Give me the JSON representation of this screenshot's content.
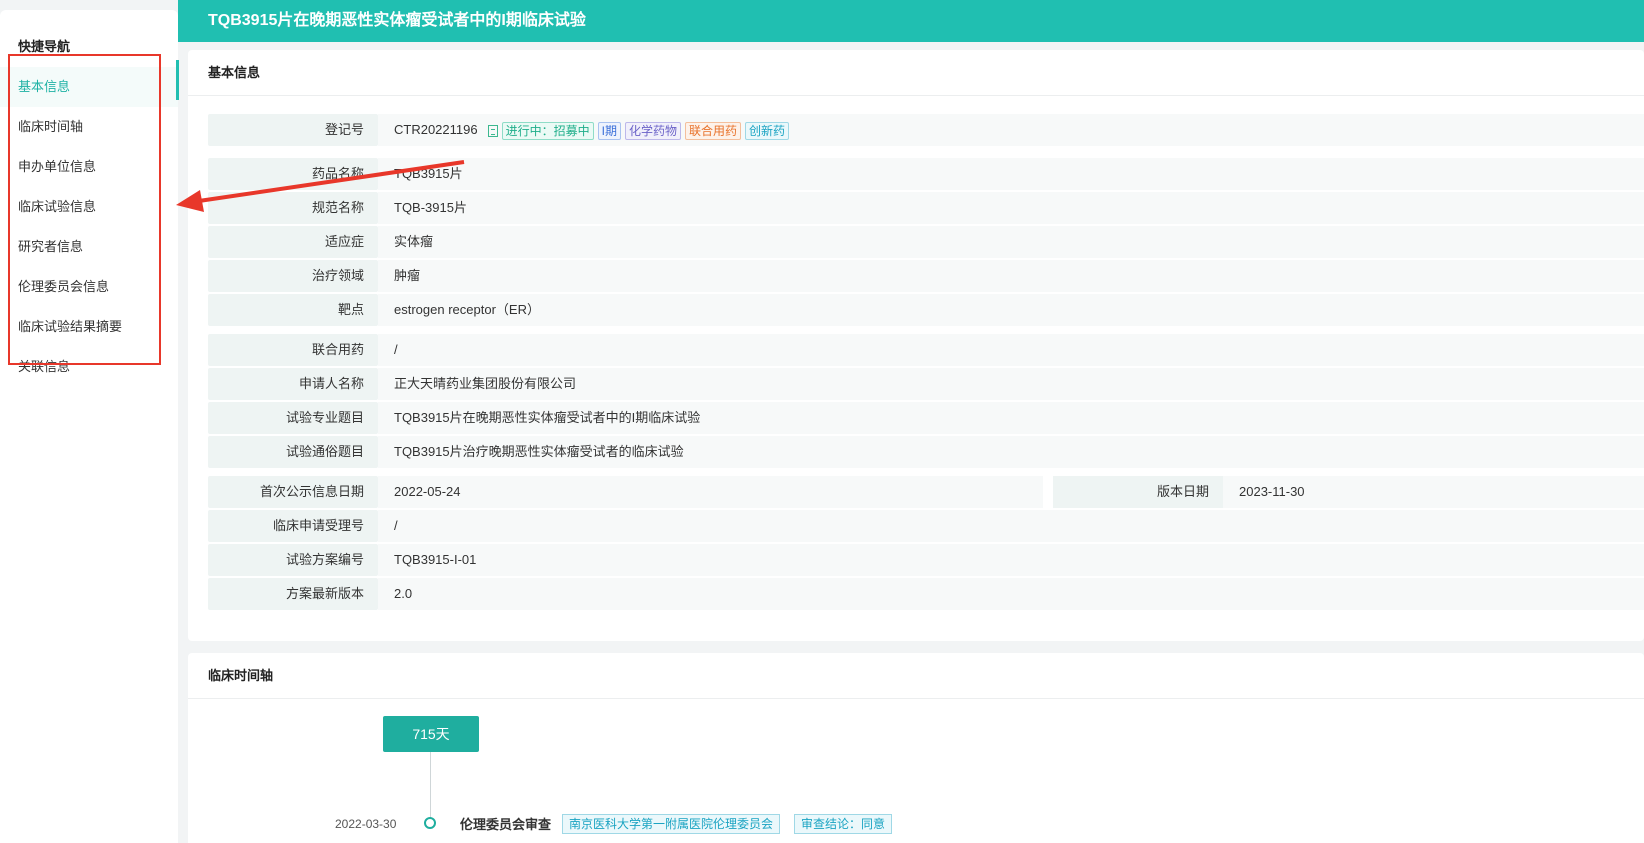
{
  "sidebar": {
    "title": "快捷导航",
    "items": [
      {
        "label": "基本信息"
      },
      {
        "label": "临床时间轴"
      },
      {
        "label": "申办单位信息"
      },
      {
        "label": "临床试验信息"
      },
      {
        "label": "研究者信息"
      },
      {
        "label": "伦理委员会信息"
      },
      {
        "label": "临床试验结果摘要"
      },
      {
        "label": "关联信息"
      }
    ]
  },
  "header": {
    "title": "TQB3915片在晚期恶性实体瘤受试者中的I期临床试验"
  },
  "basic_info": {
    "section_title": "基本信息",
    "reg_no": {
      "label": "登记号",
      "value": "CTR20221196"
    },
    "tags": [
      "进行中：招募中",
      "I期",
      "化学药物",
      "联合用药",
      "创新药"
    ],
    "group1": [
      {
        "label": "药品名称",
        "value": "TQB3915片"
      },
      {
        "label": "规范名称",
        "value": "TQB-3915片"
      },
      {
        "label": "适应症",
        "value": "实体瘤"
      },
      {
        "label": "治疗领域",
        "value": "肿瘤"
      },
      {
        "label": "靶点",
        "value": "estrogen receptor（ER）"
      }
    ],
    "group2": [
      {
        "label": "联合用药",
        "value": "/"
      },
      {
        "label": "申请人名称",
        "value": "正大天晴药业集团股份有限公司"
      },
      {
        "label": "试验专业题目",
        "value": "TQB3915片在晚期恶性实体瘤受试者中的I期临床试验"
      },
      {
        "label": "试验通俗题目",
        "value": "TQB3915片治疗晚期恶性实体瘤受试者的临床试验"
      }
    ],
    "first_pub": {
      "label": "首次公示信息日期",
      "value": "2022-05-24"
    },
    "version_date": {
      "label": "版本日期",
      "value": "2023-11-30"
    },
    "group3": [
      {
        "label": "临床申请受理号",
        "value": "/"
      },
      {
        "label": "试验方案编号",
        "value": "TQB3915-I-01"
      },
      {
        "label": "方案最新版本",
        "value": "2.0"
      }
    ]
  },
  "timeline": {
    "section_title": "临床时间轴",
    "duration": "715天",
    "date": "2022-03-30",
    "event": "伦理委员会审查",
    "org": "南京医科大学第一附属医院伦理委员会",
    "conclusion": "审查结论：同意"
  },
  "colors": {
    "accent": "#20bfb1",
    "highlight_box": "#e8372a"
  }
}
